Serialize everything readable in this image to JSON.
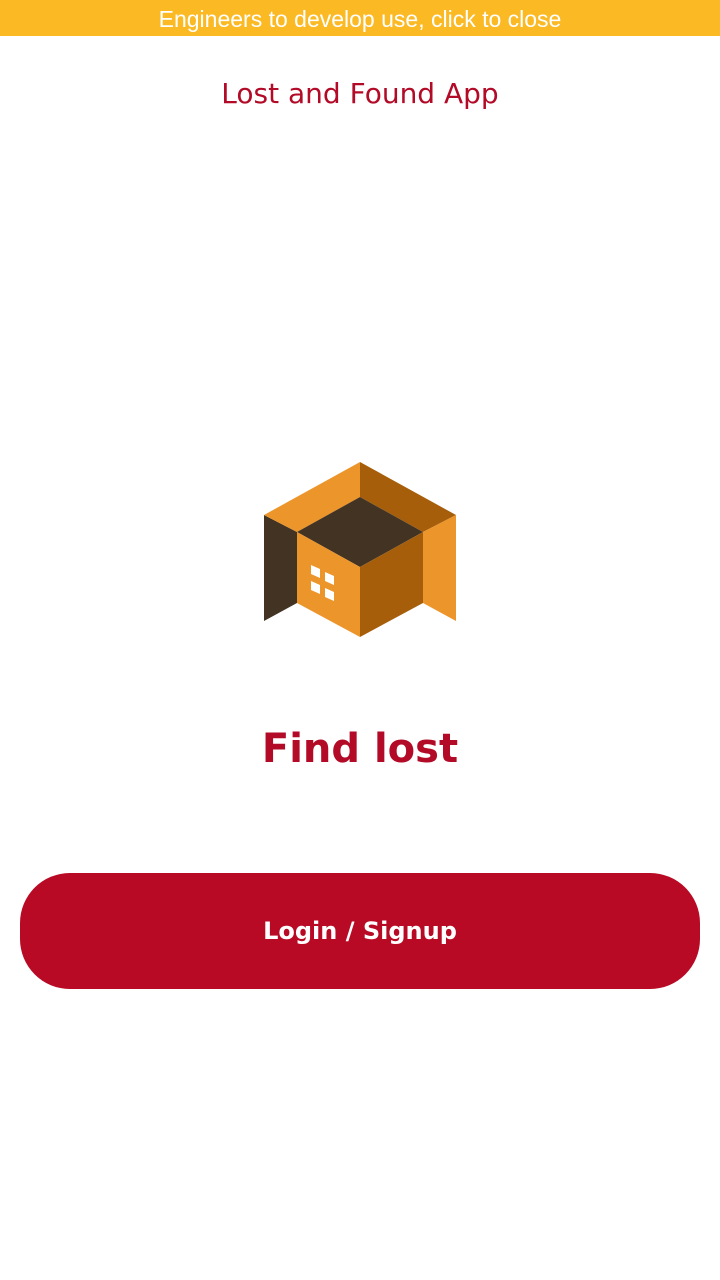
{
  "dev_banner": {
    "text": "Engineers to develop use, click to close",
    "color": "#fbb924"
  },
  "header": {
    "title": "Lost and Found App"
  },
  "logo": {
    "icon": "open-box-house-icon",
    "colors": {
      "light_orange": "#ec952a",
      "dark_orange": "#a65e0b",
      "dark_brown": "#433322"
    }
  },
  "main": {
    "tagline": "Find lost",
    "login_button_label": "Login / Signup"
  },
  "theme": {
    "brand_red": "#b80a25",
    "text_red": "#b20a27"
  }
}
